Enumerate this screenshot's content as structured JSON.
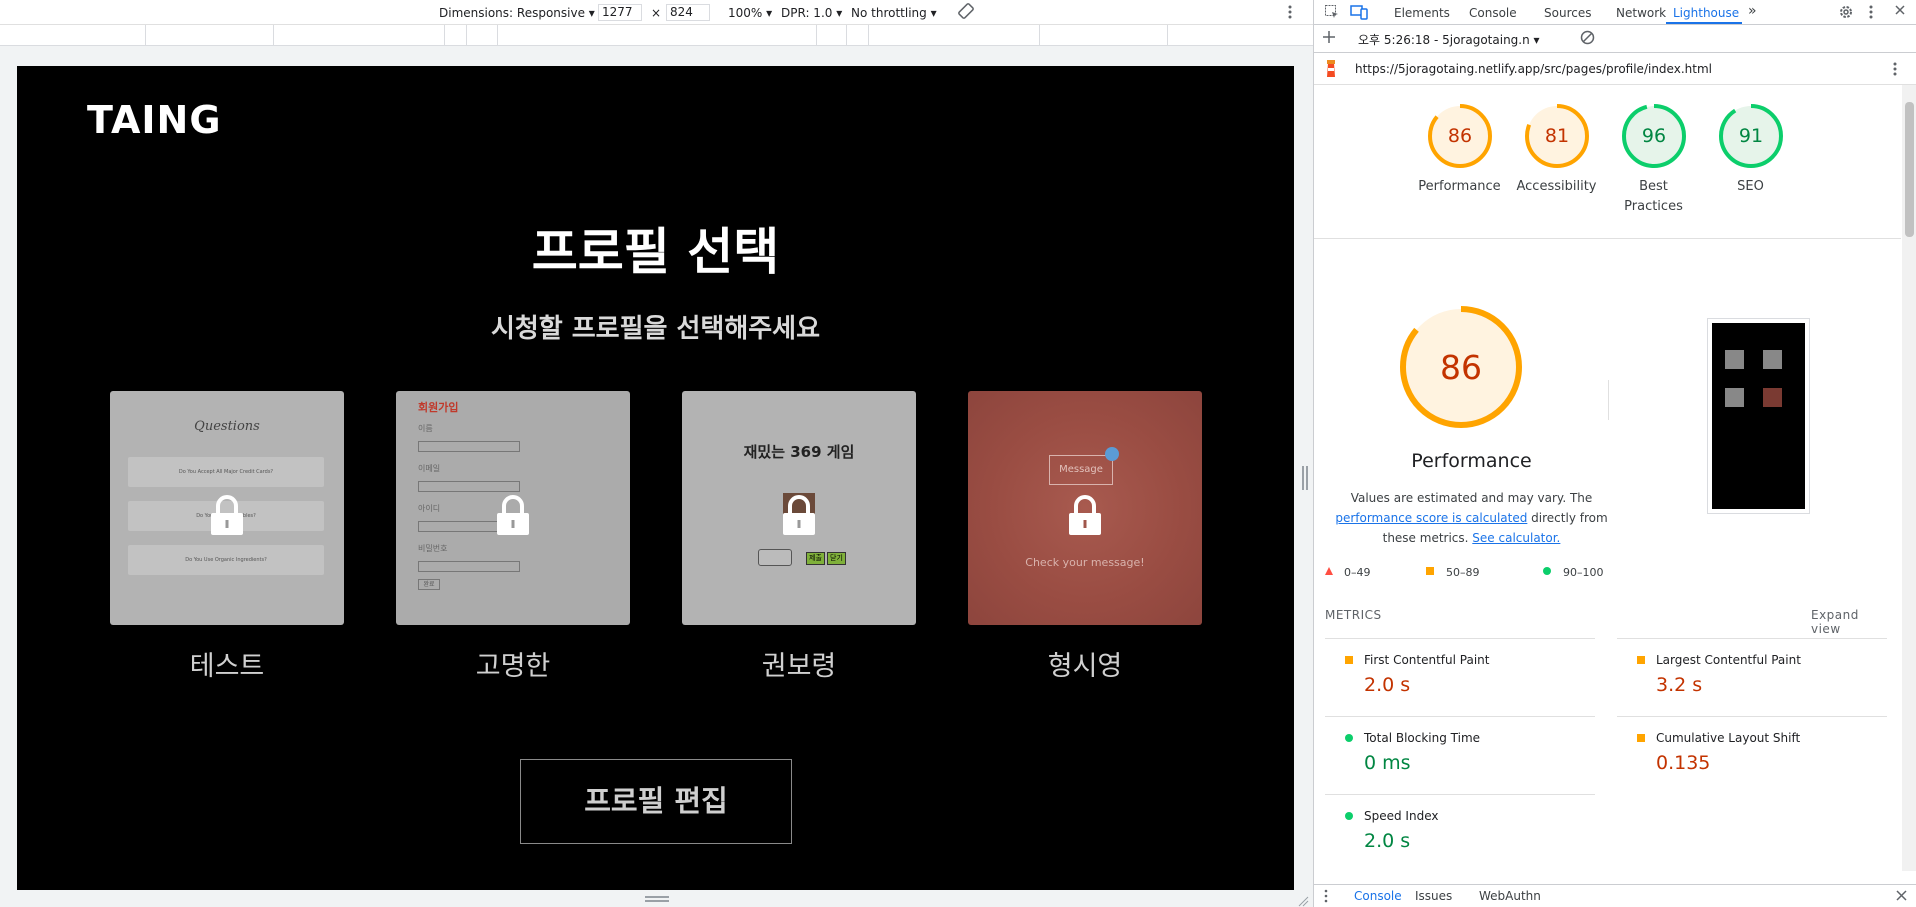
{
  "device_toolbar": {
    "dimensions_label": "Dimensions: Responsive ▾",
    "width": "1277",
    "times": "×",
    "height": "824",
    "zoom": "100% ▾",
    "dpr": "DPR: 1.0 ▾",
    "throttling": "No throttling ▾"
  },
  "page": {
    "logo": "TAING",
    "title": "프로필 선택",
    "subtitle": "시청할 프로필을 선택해주세요",
    "profiles": [
      {
        "name": "테스트",
        "preview_heading": "Questions",
        "preview_rows": [
          "Do You Accept All Major Credit Cards?",
          "Do You Sell Vegetables?",
          "Do You Use Organic Ingredients?"
        ]
      },
      {
        "name": "고명한",
        "preview_heading": "회원가입",
        "preview_fields": [
          "이름",
          "이메일",
          "아이디",
          "비밀번호"
        ],
        "preview_button": "완료"
      },
      {
        "name": "권보령",
        "preview_heading": "재밌는 369 게임",
        "preview_buttons": [
          "제출",
          "닫기"
        ]
      },
      {
        "name": "형시영",
        "preview_input": "Message",
        "preview_text": "Check your message!"
      }
    ],
    "edit_button": "프로필 편집"
  },
  "devtools": {
    "tabs": [
      "Elements",
      "Console",
      "Sources",
      "Network",
      "Lighthouse"
    ],
    "active_tab": "Lighthouse",
    "more_tabs": "»",
    "report_selector": "오후 5:26:18 - 5joragotaing.n ▾",
    "url": "https://5joragotaing.netlify.app/src/pages/profile/index.html",
    "scores": [
      {
        "label": "Performance",
        "value": "86",
        "color": "#ffa400",
        "fill": "#fff3e0",
        "text": "#c33300"
      },
      {
        "label": "Accessibility",
        "value": "81",
        "color": "#ffa400",
        "fill": "#fff3e0",
        "text": "#c33300"
      },
      {
        "label": "Best Practices",
        "value": "96",
        "color": "#0cce6b",
        "fill": "#e6f4ea",
        "text": "#018642"
      },
      {
        "label": "SEO",
        "value": "91",
        "color": "#0cce6b",
        "fill": "#e6f4ea",
        "text": "#018642"
      }
    ],
    "performance": {
      "score": "86",
      "title": "Performance",
      "desc_1": "Values are estimated and may vary. The",
      "desc_link": "performance score is calculated",
      "desc_2": "directly from",
      "desc_3": "these metrics.",
      "calc_link": "See calculator."
    },
    "legend": [
      {
        "range": "0–49",
        "shape": "triangle",
        "color": "#ff4e42"
      },
      {
        "range": "50–89",
        "shape": "square",
        "color": "#ffa400"
      },
      {
        "range": "90–100",
        "shape": "circle",
        "color": "#0cce6b"
      }
    ],
    "metrics_label": "METRICS",
    "expand_view": "Expand view",
    "metrics": [
      {
        "name": "First Contentful Paint",
        "value": "2.0 s",
        "status": "average"
      },
      {
        "name": "Largest Contentful Paint",
        "value": "3.2 s",
        "status": "average"
      },
      {
        "name": "Total Blocking Time",
        "value": "0 ms",
        "status": "pass"
      },
      {
        "name": "Cumulative Layout Shift",
        "value": "0.135",
        "status": "average"
      },
      {
        "name": "Speed Index",
        "value": "2.0 s",
        "status": "pass"
      }
    ],
    "drawer_tabs": [
      "Console",
      "Issues",
      "WebAuthn"
    ]
  }
}
